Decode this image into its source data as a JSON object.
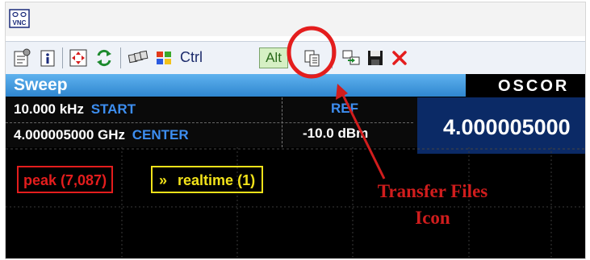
{
  "titlebar": {
    "app_icon": "vnc-icon",
    "app_icon_text": "VNC"
  },
  "toolbar": {
    "buttons": [
      {
        "name": "properties-icon"
      },
      {
        "name": "info-icon"
      },
      {
        "name": "full-screen-icon"
      },
      {
        "name": "refresh-icon"
      },
      {
        "name": "ctrl-alt-del-icon"
      },
      {
        "name": "start-menu-icon"
      },
      {
        "name": "ctrl-toggle",
        "label": "Ctrl"
      },
      {
        "name": "alt-toggle",
        "label": "Alt"
      },
      {
        "name": "transfer-files-icon"
      },
      {
        "name": "new-connection-icon"
      },
      {
        "name": "save-icon"
      },
      {
        "name": "close-icon"
      }
    ]
  },
  "app": {
    "sweep_title": "Sweep",
    "brand": "OSCOR",
    "start_value": "10.000 kHz",
    "start_label": "START",
    "center_value": "4.000005000 GHz",
    "center_label": "CENTER",
    "ref_label": "REF",
    "ref_value": "-10.0 dBm",
    "center_display": "4.000005000",
    "peak_trace": "peak (7,087)",
    "realtime_trace": "realtime (1)",
    "realtime_marker": "»"
  },
  "annotation": {
    "line1": "Transfer Files",
    "line2": "Icon"
  },
  "colors": {
    "sweep_bar": "#3d9ae6",
    "start_center_keyword": "#3d8ef0",
    "center_panel": "#0b2a66",
    "peak": "#e41d1d",
    "realtime": "#f2e21a",
    "annotation_red": "#d11d1d"
  }
}
